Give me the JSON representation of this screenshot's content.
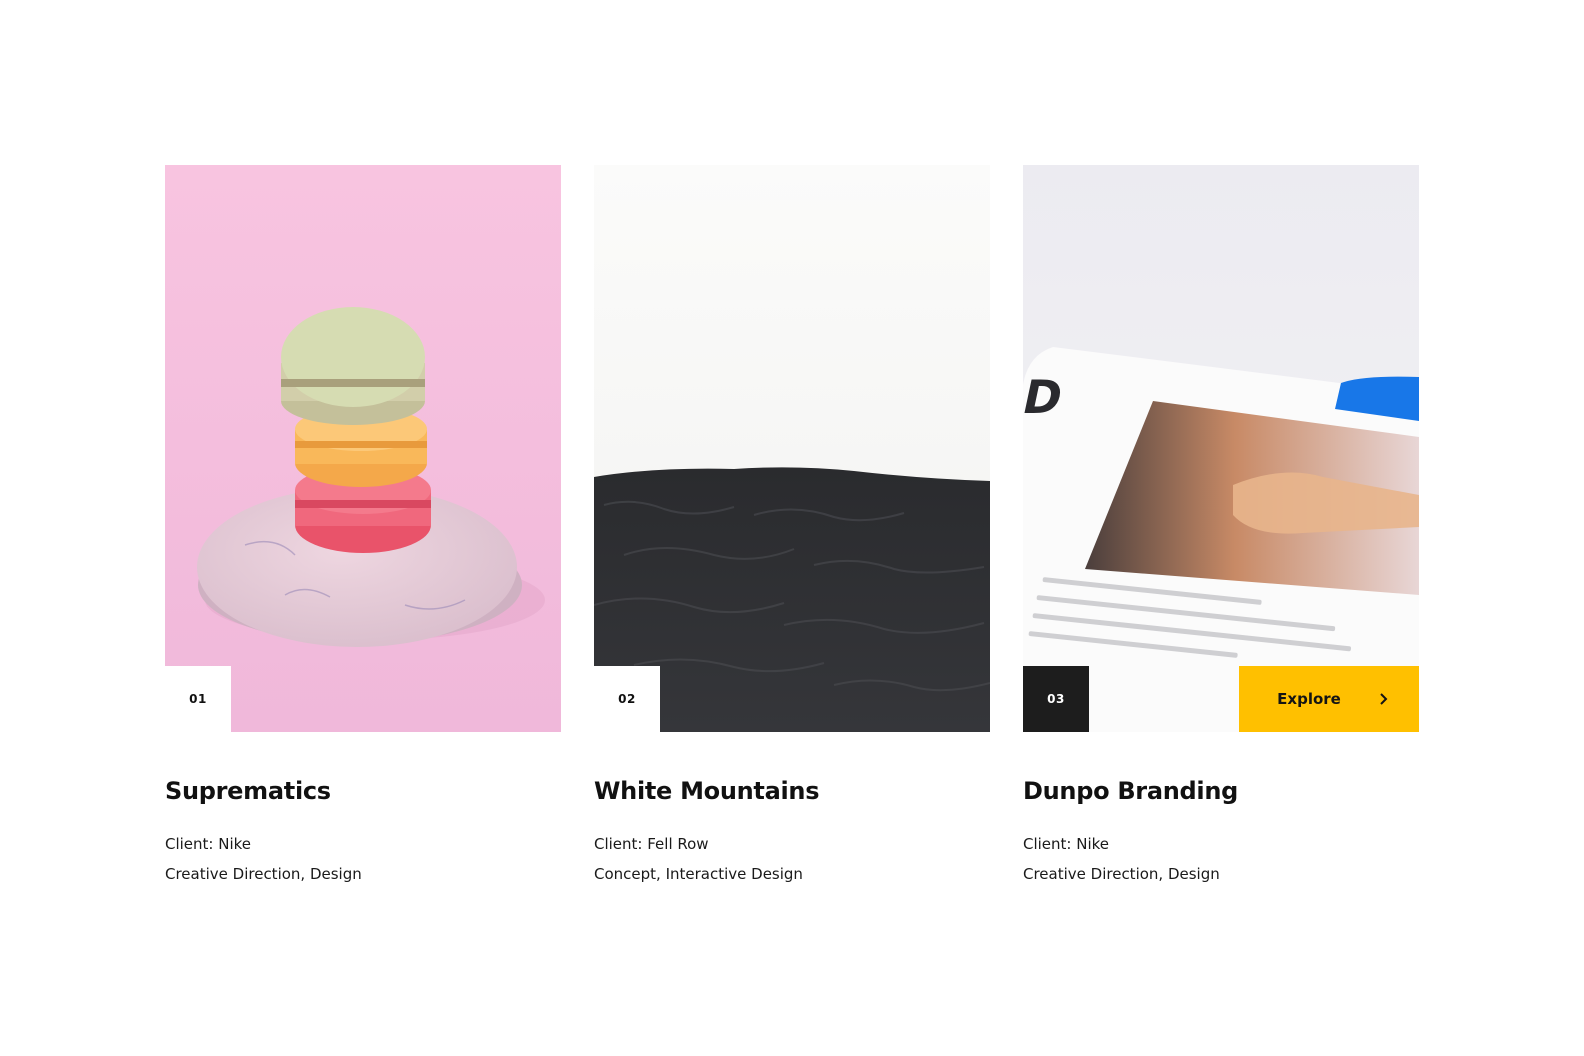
{
  "projects": [
    {
      "number": "01",
      "title": "Suprematics",
      "client": "Client: Nike",
      "services": "Creative Direction, Design",
      "image": "macarons-on-stone-photo",
      "background_color": "#f5c1df"
    },
    {
      "number": "02",
      "title": "White Mountains",
      "client": "Client: Fell Row",
      "services": "Concept, Interactive Design",
      "image": "black-sand-dunes-photo",
      "background_color": "#f8f8f8"
    },
    {
      "number": "03",
      "title": "Dunpo Branding",
      "client": "Client: Nike",
      "services": "Creative Direction, Design",
      "image": "branding-print-photo",
      "background_color": "#edecf0",
      "explore_label": "Explore"
    }
  ],
  "colors": {
    "accent": "#ffc000",
    "dark_badge": "#1d1d1d",
    "text": "#111111"
  }
}
